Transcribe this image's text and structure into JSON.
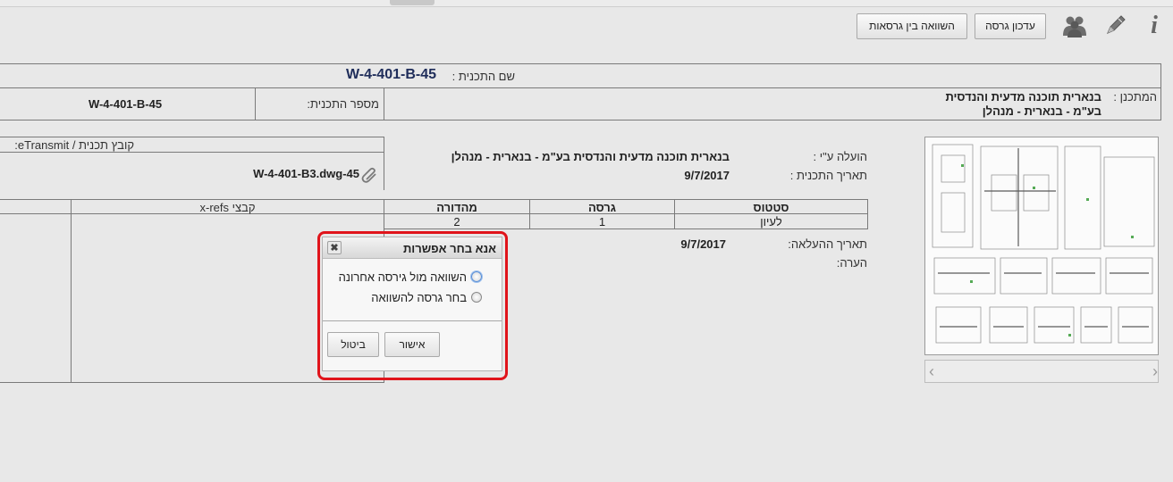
{
  "toolbar": {
    "compare_versions_label": "השוואה בין גרסאות",
    "update_version_label": "עדכון גרסה"
  },
  "plan": {
    "name_label": "שם התכנית :",
    "name_value": "W-4-401-B-45",
    "planner_label": "המתכנן :",
    "planner_value_line1": "בנארית תוכנה מדעית והנדסית",
    "planner_value_line2": "בע\"מ - בנארית - מנהלן",
    "number_label": "מספר התכנית:",
    "number_value": "45-W-4-401-B"
  },
  "details": {
    "uploaded_by_label": "הועלה ע\"י :",
    "uploaded_by_value": "בנארית תוכנה מדעית והנדסית בע\"מ - בנארית - מנהלן",
    "plan_date_label": "תאריך התכנית :",
    "plan_date_value": "9/7/2017",
    "upload_date_label": "תאריך ההעלאה:",
    "upload_date_value": "9/7/2017",
    "note_label": "הערה:"
  },
  "file_section": {
    "header": "קובץ תכנית / eTransmit:",
    "file_name": "W-4-401-B3.dwg-45"
  },
  "versions_table": {
    "headers": [
      "סטטוס",
      "גרסה",
      "מהדורה"
    ],
    "row": [
      "לעיון",
      "1",
      "2"
    ]
  },
  "xrefs": {
    "header": "קבצי x-refs"
  },
  "dialog": {
    "title": "אנא בחר אפשרות",
    "option1": "השוואה מול גירסה אחרונה",
    "option2": "בחר גרסה להשוואה",
    "ok_label": "אישור",
    "cancel_label": "ביטול"
  },
  "icons": {
    "info": "info-icon",
    "edit": "pencil-icon",
    "users": "users-icon",
    "close": "close-icon"
  },
  "colors": {
    "highlight": "#e0141b",
    "plan_name": "#1f2d5a"
  }
}
